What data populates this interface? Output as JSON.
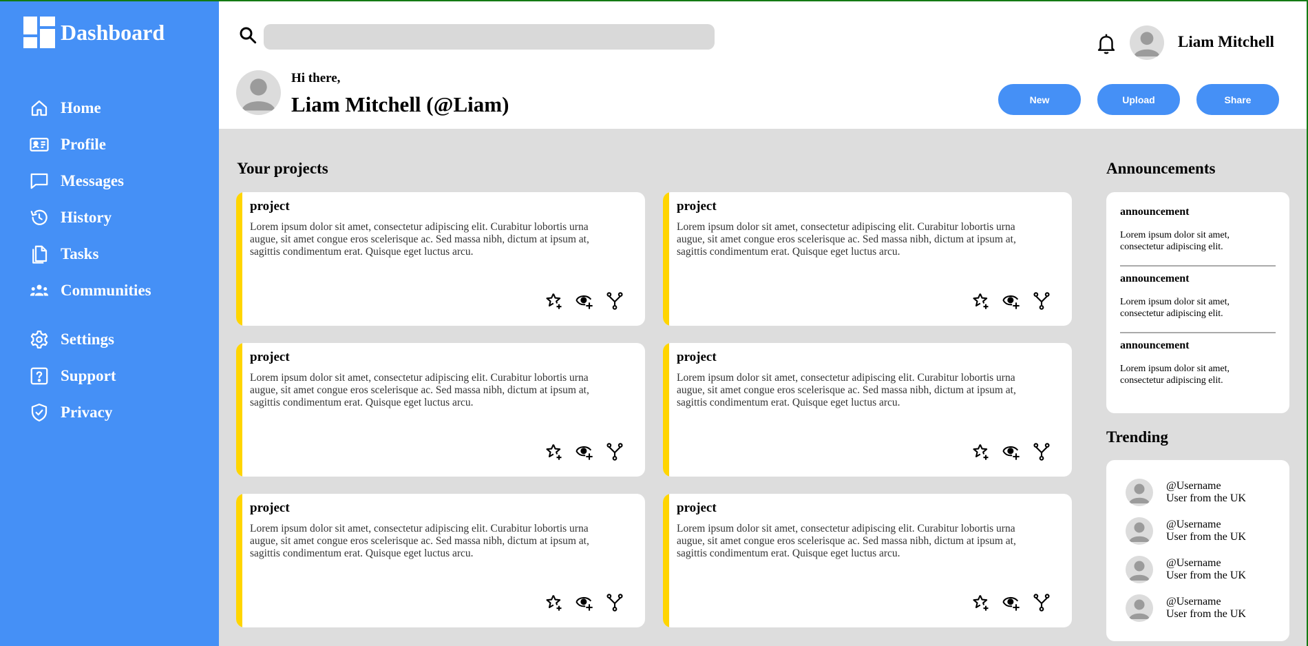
{
  "sidebar": {
    "brand": "Dashboard",
    "items": [
      {
        "label": "Home",
        "icon": "home-icon"
      },
      {
        "label": "Profile",
        "icon": "id-card-icon"
      },
      {
        "label": "Messages",
        "icon": "message-icon"
      },
      {
        "label": "History",
        "icon": "history-icon"
      },
      {
        "label": "Tasks",
        "icon": "tasks-icon"
      },
      {
        "label": "Communities",
        "icon": "communities-icon"
      },
      {
        "label": "Settings",
        "icon": "gear-icon"
      },
      {
        "label": "Support",
        "icon": "help-icon"
      },
      {
        "label": "Privacy",
        "icon": "shield-icon"
      }
    ]
  },
  "header": {
    "search_placeholder": "",
    "username": "Liam Mitchell",
    "greeting": "Hi there,",
    "fullname": "Liam Mitchell (@Liam)",
    "buttons": [
      "New",
      "Upload",
      "Share"
    ]
  },
  "projects": {
    "title": "Your projects",
    "items": [
      {
        "title": "project",
        "desc": "Lorem ipsum dolor sit amet, consectetur adipiscing elit. Curabitur lobortis urna augue, sit amet congue eros scelerisque ac. Sed massa nibh, dictum at ipsum at, sagittis condimentum erat. Quisque eget luctus arcu."
      },
      {
        "title": "project",
        "desc": "Lorem ipsum dolor sit amet, consectetur adipiscing elit. Curabitur lobortis urna augue, sit amet congue eros scelerisque ac. Sed massa nibh, dictum at ipsum at, sagittis condimentum erat. Quisque eget luctus arcu."
      },
      {
        "title": "project",
        "desc": "Lorem ipsum dolor sit amet, consectetur adipiscing elit. Curabitur lobortis urna augue, sit amet congue eros scelerisque ac. Sed massa nibh, dictum at ipsum at, sagittis condimentum erat. Quisque eget luctus arcu."
      },
      {
        "title": "project",
        "desc": "Lorem ipsum dolor sit amet, consectetur adipiscing elit. Curabitur lobortis urna augue, sit amet congue eros scelerisque ac. Sed massa nibh, dictum at ipsum at, sagittis condimentum erat. Quisque eget luctus arcu."
      },
      {
        "title": "project",
        "desc": "Lorem ipsum dolor sit amet, consectetur adipiscing elit. Curabitur lobortis urna augue, sit amet congue eros scelerisque ac. Sed massa nibh, dictum at ipsum at, sagittis condimentum erat. Quisque eget luctus arcu."
      },
      {
        "title": "project",
        "desc": "Lorem ipsum dolor sit amet, consectetur adipiscing elit. Curabitur lobortis urna augue, sit amet congue eros scelerisque ac. Sed massa nibh, dictum at ipsum at, sagittis condimentum erat. Quisque eget luctus arcu."
      }
    ]
  },
  "announcements": {
    "title": "Announcements",
    "items": [
      {
        "title": "announcement",
        "desc": "Lorem ipsum dolor sit amet, consectetur adipiscing elit."
      },
      {
        "title": "announcement",
        "desc": "Lorem ipsum dolor sit amet, consectetur adipiscing elit."
      },
      {
        "title": "announcement",
        "desc": "Lorem ipsum dolor sit amet, consectetur adipiscing elit."
      }
    ]
  },
  "trending": {
    "title": "Trending",
    "items": [
      {
        "handle": "@Username",
        "sub": "User from the UK"
      },
      {
        "handle": "@Username",
        "sub": "User from the UK"
      },
      {
        "handle": "@Username",
        "sub": "User from the UK"
      },
      {
        "handle": "@Username",
        "sub": "User from the UK"
      }
    ]
  },
  "colors": {
    "accent": "#4590f6",
    "card_stripe": "#ffd500",
    "background": "#dddddd"
  }
}
